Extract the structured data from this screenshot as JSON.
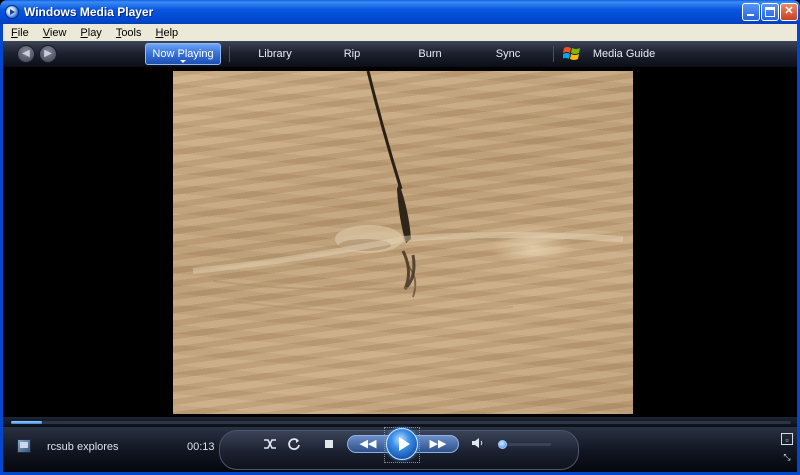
{
  "window": {
    "title": "Windows Media Player"
  },
  "menu": {
    "items": [
      {
        "hotkey": "F",
        "rest": "ile"
      },
      {
        "hotkey": "V",
        "rest": "iew"
      },
      {
        "hotkey": "P",
        "rest": "lay"
      },
      {
        "hotkey": "T",
        "rest": "ools"
      },
      {
        "hotkey": "H",
        "rest": "elp"
      }
    ]
  },
  "nav": {
    "tabs": [
      "Now Playing",
      "Library",
      "Rip",
      "Burn",
      "Sync",
      "Media Guide"
    ],
    "active_tab": "Now Playing"
  },
  "player": {
    "title": "rcsub explores",
    "time": "00:13",
    "progress_fraction": 0.04,
    "volume_fraction": 0.05
  },
  "icons": {
    "app": "media-player-icon",
    "back": "back-arrow-icon",
    "forward": "forward-arrow-icon",
    "media_guide": "windows-logo-icon",
    "shuffle": "shuffle-icon",
    "repeat": "repeat-icon",
    "stop": "stop-icon",
    "rewind": "rewind-icon",
    "play": "play-icon",
    "fast_forward": "fast-forward-icon",
    "mute": "speaker-icon"
  },
  "colors": {
    "titlebar": "#0857e0",
    "active_tab": "#3a74d9",
    "play_button": "#3c8fe8"
  }
}
